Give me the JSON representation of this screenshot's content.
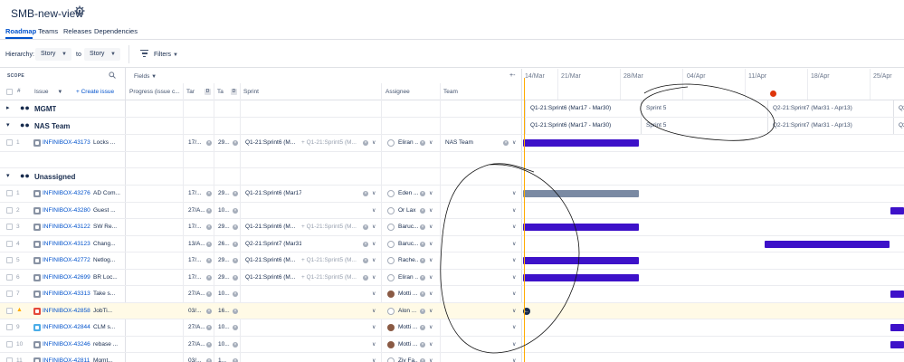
{
  "header": {
    "title": "SMB-new-view",
    "tabs": [
      {
        "label": "Roadmap"
      },
      {
        "label": "Teams"
      },
      {
        "label": "Releases"
      },
      {
        "label": "Dependencies"
      }
    ]
  },
  "toolbar": {
    "hierarchy_label": "Hierarchy:",
    "from_value": "Story",
    "to_label": "to",
    "to_value": "Story",
    "filters_label": "Filters"
  },
  "scope": {
    "label": "SCOPE",
    "fields_label": "Fields"
  },
  "columns": {
    "num": "#",
    "issue": "Issue",
    "create": "+ Create issue",
    "progress": "Progress (issue c...",
    "target_start": "Tar",
    "target_end": "Ta",
    "sprint": "Sprint",
    "assignee": "Assignee",
    "team": "Team"
  },
  "timeline": {
    "dates": [
      "14/Mar",
      "21/Mar",
      "28/Mar",
      "04/Apr",
      "11/Apr",
      "18/Apr",
      "25/Apr"
    ],
    "collapse_icon": "+-"
  },
  "groups": {
    "mgmt": "MGMT",
    "nas": "NAS Team",
    "unassigned": "Unassigned"
  },
  "sprint_lanes": {
    "mgmt": [
      "Q1-21:Sprint6 (Mar17 - Mar30)",
      "Sprint 5",
      "Q2-21:Sprint7 (Mar31 - Apr13)",
      "Q2"
    ],
    "nas": [
      "Q1-21:Sprint6 (Mar17 - Mar30)",
      "Sprint 5",
      "Q2-21:Sprint7 (Mar31 - Apr13)",
      "Q2"
    ]
  },
  "nas_rows": [
    {
      "num": "1",
      "key": "INFINIBOX-43173",
      "summary": "Locks ...",
      "start": "17/...",
      "end": "29...",
      "sprint": "Q1-21:Sprint6 (M...",
      "sprint_extra": "+ Q1-21:Sprint5 (M...",
      "assignee": "Eliran ...",
      "team": "NAS Team"
    }
  ],
  "rows": [
    {
      "num": "1",
      "key": "INFINIBOX-43276",
      "summary": "AD Com...",
      "start": "17/...",
      "end": "29...",
      "sprint": "Q1-21:Sprint6 (Mar17 - Mar30)",
      "sprint_extra": "",
      "assignee": "Eden ...",
      "team": ""
    },
    {
      "num": "2",
      "key": "INFINIBOX-43280",
      "summary": "Guest ...",
      "start": "27/A...",
      "end": "10...",
      "sprint": "",
      "sprint_extra": "",
      "assignee": "Or Lax",
      "team": ""
    },
    {
      "num": "3",
      "key": "INFINIBOX-43122",
      "summary": "SW Re...",
      "start": "17/...",
      "end": "29...",
      "sprint": "Q1-21:Sprint6 (M...",
      "sprint_extra": "+ Q1-21:Sprint5 (M...",
      "assignee": "Baruc...",
      "team": ""
    },
    {
      "num": "4",
      "key": "INFINIBOX-43123",
      "summary": "Chang...",
      "start": "13/A...",
      "end": "26...",
      "sprint": "Q2-21:Sprint7 (Mar31 - Apr13)",
      "sprint_extra": "",
      "assignee": "Baruc...",
      "team": ""
    },
    {
      "num": "5",
      "key": "INFINIBOX-42772",
      "summary": "Netlog...",
      "start": "17/...",
      "end": "29...",
      "sprint": "Q1-21:Sprint6 (M...",
      "sprint_extra": "+ Q1-21:Sprint5 (M...",
      "assignee": "Rache...",
      "team": ""
    },
    {
      "num": "6",
      "key": "INFINIBOX-42699",
      "summary": "BR Loc...",
      "start": "17/...",
      "end": "29...",
      "sprint": "Q1-21:Sprint6 (M...",
      "sprint_extra": "+ Q1-21:Sprint5 (M...",
      "assignee": "Eliran ...",
      "team": ""
    },
    {
      "num": "7",
      "key": "INFINIBOX-43313",
      "summary": "Take s...",
      "start": "27/A...",
      "end": "10...",
      "sprint": "",
      "sprint_extra": "",
      "assignee": "Motti ...",
      "team": ""
    },
    {
      "num": "8",
      "key": "INFINIBOX-42858",
      "summary": "JobTi...",
      "start": "03/...",
      "end": "16...",
      "sprint": "",
      "sprint_extra": "",
      "assignee": "Alon ...",
      "team": ""
    },
    {
      "num": "9",
      "key": "INFINIBOX-42844",
      "summary": "CLM s...",
      "start": "27/A...",
      "end": "10...",
      "sprint": "",
      "sprint_extra": "",
      "assignee": "Motti ...",
      "team": ""
    },
    {
      "num": "10",
      "key": "INFINIBOX-43246",
      "summary": "rebase ...",
      "start": "27/A...",
      "end": "10...",
      "sprint": "",
      "sprint_extra": "",
      "assignee": "Motti ...",
      "team": ""
    },
    {
      "num": "11",
      "key": "INFINIBOX-42811",
      "summary": "Mgmt...",
      "start": "03/...",
      "end": "1...",
      "sprint": "",
      "sprint_extra": "",
      "assignee": "Ziv Fa...",
      "team": ""
    }
  ],
  "colors": {
    "accent": "#0052cc",
    "bar": "#3d11c9",
    "bar_grey": "#7a8aa3",
    "today": "#ffab00"
  }
}
